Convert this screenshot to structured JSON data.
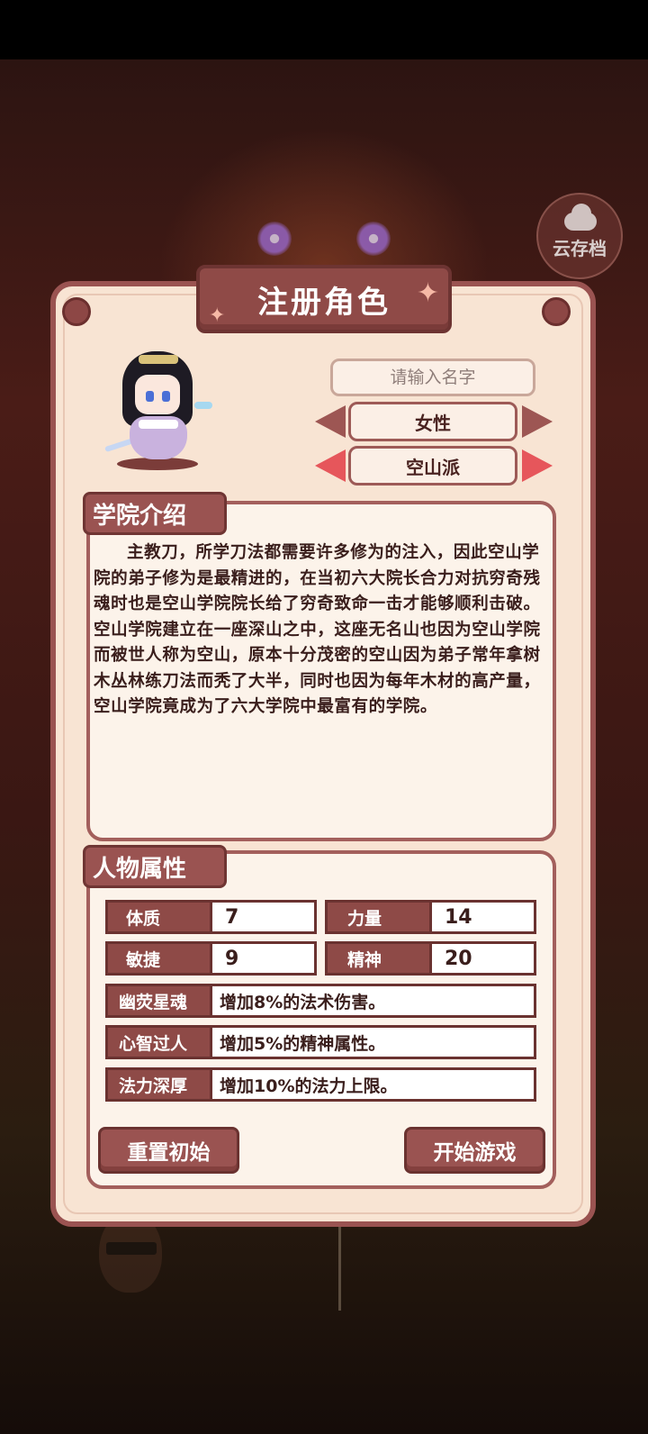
{
  "cloud_save": {
    "label": "云存档"
  },
  "title": "注册角色",
  "name_input": {
    "placeholder": "请输入名字",
    "value": ""
  },
  "gender": {
    "selected": "女性"
  },
  "school": {
    "selected": "空山派"
  },
  "intro": {
    "heading": "学院介绍",
    "text": "主教刀，所学刀法都需要许多修为的注入，因此空山学院的弟子修为是最精进的，在当初六大院长合力对抗穷奇残魂时也是空山学院院长给了穷奇致命一击才能够顺利击破。空山学院建立在一座深山之中，这座无名山也因为空山学院而被世人称为空山，原本十分茂密的空山因为弟子常年拿树木丛林练刀法而秃了大半，同时也因为每年木材的高产量，空山学院竟成为了六大学院中最富有的学院。"
  },
  "attributes": {
    "heading": "人物属性",
    "stats": [
      {
        "label": "体质",
        "value": "7"
      },
      {
        "label": "力量",
        "value": "14"
      },
      {
        "label": "敏捷",
        "value": "9"
      },
      {
        "label": "精神",
        "value": "20"
      }
    ],
    "traits": [
      {
        "label": "幽荧星魂",
        "desc": "增加8%的法术伤害。"
      },
      {
        "label": "心智过人",
        "desc": "增加5%的精神属性。"
      },
      {
        "label": "法力深厚",
        "desc": "增加10%的法力上限。"
      }
    ]
  },
  "buttons": {
    "reset": "重置初始",
    "start": "开始游戏"
  },
  "colors": {
    "panel_bg": "#f8e4d3",
    "accent": "#9a5351",
    "arrow_active": "#e6565b"
  },
  "icons": [
    "cloud-icon",
    "left-arrow-icon",
    "right-arrow-icon",
    "sparkle-icon"
  ]
}
